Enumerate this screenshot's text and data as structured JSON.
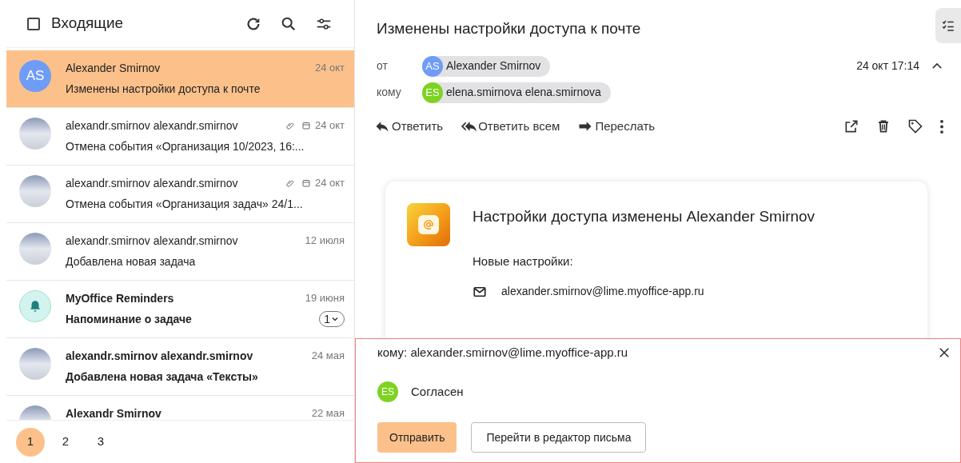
{
  "folder": {
    "title": "Входящие",
    "checked": false
  },
  "messages": [
    {
      "sender": "Alexander Smirnov",
      "subject": "Изменены настройки доступа к почте",
      "date": "24 окт",
      "avatar": {
        "kind": "initials",
        "text": "AS",
        "color": "#6e9cf7"
      },
      "selected": true,
      "unread": false,
      "attachment": false,
      "event": false
    },
    {
      "sender": "alexandr.smirnov alexandr.smirnov",
      "subject": "Отмена события «Организация 10/2023, 16:...",
      "date": "24 окт",
      "avatar": {
        "kind": "photo"
      },
      "selected": false,
      "unread": false,
      "attachment": true,
      "event": true
    },
    {
      "sender": "alexandr.smirnov alexandr.smirnov",
      "subject": "Отмена события «Организация задач» 24/1...",
      "date": "24 окт",
      "avatar": {
        "kind": "photo"
      },
      "selected": false,
      "unread": false,
      "attachment": true,
      "event": true
    },
    {
      "sender": "alexandr.smirnov alexandr.smirnov",
      "subject": "Добавлена новая задача",
      "date": "12 июля",
      "avatar": {
        "kind": "photo"
      },
      "selected": false,
      "unread": false,
      "attachment": false,
      "event": false
    },
    {
      "sender": "MyOffice Reminders",
      "subject": "Напоминание о задаче",
      "date": "19 июня",
      "avatar": {
        "kind": "bell"
      },
      "selected": false,
      "unread": true,
      "attachment": false,
      "event": false,
      "count": "1"
    },
    {
      "sender": "alexandr.smirnov alexandr.smirnov",
      "subject": "Добавлена новая задача «Тексты»",
      "date": "24 мая",
      "avatar": {
        "kind": "photo"
      },
      "selected": false,
      "unread": true,
      "attachment": false,
      "event": false
    },
    {
      "sender": "Alexandr Smirnov",
      "date": "22 мая",
      "avatar": {
        "kind": "photo"
      },
      "selected": false,
      "unread": true,
      "attachment": false,
      "event": false
    }
  ],
  "pages": [
    {
      "label": "1",
      "selected": true
    },
    {
      "label": "2",
      "selected": false
    },
    {
      "label": "3",
      "selected": false
    }
  ],
  "message": {
    "subject": "Изменены настройки доступа к почте",
    "from_label": "от",
    "from": {
      "initials": "AS",
      "name": "Alexander Smirnov",
      "color": "#6e9cf7"
    },
    "to_label": "кому",
    "to": {
      "initials": "ES",
      "name": "elena.smirnova elena.smirnova",
      "color": "#7ed321"
    },
    "datetime": "24 окт 17:14",
    "actions": [
      {
        "kind": "reply",
        "label": "Ответить"
      },
      {
        "kind": "reply-all",
        "label": "Ответить всем"
      },
      {
        "kind": "forward",
        "label": "Переслать"
      }
    ],
    "body": {
      "heading": "Настройки доступа изменены Alexander Smirnov",
      "intro": "Новые настройки:",
      "email": "alexander.smirnov@lime.myoffice-app.ru"
    }
  },
  "reply": {
    "to": "кому: alexander.smirnov@lime.myoffice-app.ru",
    "author_initials": "ES",
    "text": "Согласен",
    "send": "Отправить",
    "editor": "Перейти в редактор письма"
  }
}
